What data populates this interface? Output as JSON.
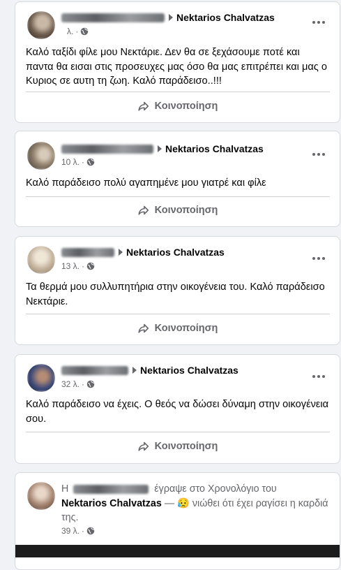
{
  "posts": [
    {
      "author_blurred": "",
      "target": "Nektarios Chalvatzas",
      "time": "λ.",
      "text": "Καλό ταξίδι φίλε μου Νεκτάριε. Δεν θα  σε ξεχάσουμε ποτέ  και παντα θα εισαι στις προσευχες μας όσο  θα μας επιτρέπει και μας ο Κυριος σε αυτη τη ζωη. Καλό παράδεισο..!!!",
      "share_label": "Κοινοποίηση"
    },
    {
      "author_blurred": "",
      "target": "Nektarios Chalvatzas",
      "time": "10 λ.",
      "text": "Καλό παράδεισο πολύ αγαπημένε μου γιατρέ και φίλε",
      "share_label": "Κοινοποίηση"
    },
    {
      "author_blurred": "",
      "target": "Nektarios Chalvatzas",
      "time": "13 λ.",
      "text": "Τα θερμά μου συλλυπητήρια στην οικογένεια του. Καλό παράδεισο Νεκτάριε.",
      "share_label": "Κοινοποίηση"
    },
    {
      "author_blurred": "",
      "target": "Nektarios Chalvatzas",
      "time": "32 λ.",
      "text": "Καλό παράδεισο να έχεις. Ο θεός να δώσει δύναμη στην οικογένεια σου.",
      "share_label": "Κοινοποίηση"
    }
  ],
  "last_post": {
    "prefix": "Η",
    "wrote_on": "έγραψε στο Χρονολόγιο του",
    "target": "Nektarios Chalvatzas",
    "feeling_sep": "—",
    "feeling_emoji": "😥",
    "feeling": "νιώθει ότι έχει ραγίσει η καρδιά της.",
    "time": "39 λ."
  }
}
